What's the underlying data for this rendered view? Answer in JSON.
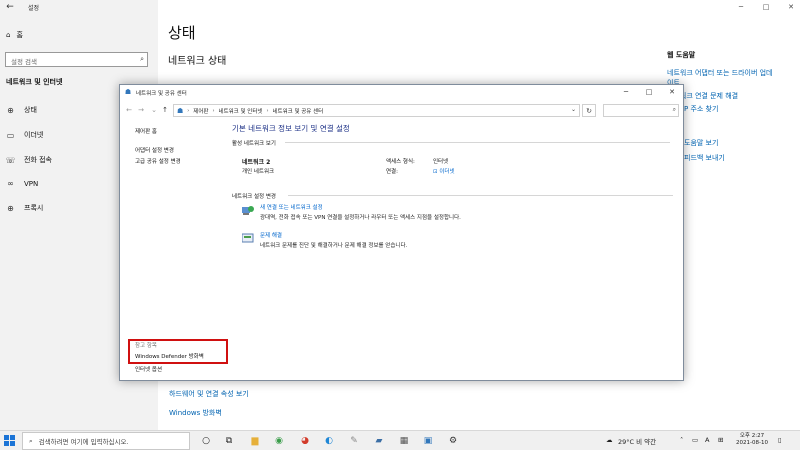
{
  "settings": {
    "window_title": "설정",
    "home": "홈",
    "search_placeholder": "설정 검색",
    "section_title": "네트워크 및 인터넷",
    "nav": [
      {
        "label": "상태",
        "icon": "home-network-icon"
      },
      {
        "label": "이더넷",
        "icon": "ethernet-icon"
      },
      {
        "label": "전화 접속",
        "icon": "dialup-icon"
      },
      {
        "label": "VPN",
        "icon": "vpn-icon"
      },
      {
        "label": "프록시",
        "icon": "globe-icon"
      }
    ],
    "page_title": "상태",
    "subtitle": "네트워크 상태",
    "help_title": "웹 도움말",
    "help_links": [
      "네트워크 어댑터 또는 드라이버 업데",
      "이트",
      "네트워크 연결 문제 해결",
      "P 주소 찾기"
    ],
    "help_links2": [
      "도움말 보기",
      "피드백 보내기"
    ],
    "bottom_links": [
      "하드웨어 및 연결 속성 보기",
      "Windows 방화벽"
    ]
  },
  "nsc": {
    "title": "네트워크 및 공유 센터",
    "breadcrumb": [
      "제어판",
      "네트워크 및 인터넷",
      "네트워크 및 공유 센터"
    ],
    "sidebar": [
      "제어판 홈",
      "어댑터 설정 변경",
      "고급 공유 설정 변경"
    ],
    "main_title": "기본 네트워크 정보 보기 및 연결 설정",
    "active_label": "활성 네트워크 보기",
    "network_name": "네트워크 2",
    "network_type": "개인 네트워크",
    "access_type_key": "액세스 형식:",
    "access_type_val": "인터넷",
    "connection_key": "연결:",
    "connection_val": "이더넷",
    "change_label": "네트워크 설정 변경",
    "task1_link": "새 연결 또는 네트워크 설정",
    "task1_desc": "광대역, 전화 접속 또는 VPN 연결을 설정하거나 라우터 또는 액세스 지점을 설정합니다.",
    "task2_link": "문제 해결",
    "task2_desc": "네트워크 문제를 진단 및 해결하거나 문제 해결 정보를 얻습니다.",
    "see_also": "참고 항목",
    "defender": "Windows Defender 방화벽",
    "internet_options": "인터넷 옵션"
  },
  "taskbar": {
    "search_placeholder": "검색하려면 여기에 입력하십시오.",
    "weather": "29°C 비 약간",
    "ime": "A",
    "clock_time": "오후 2:27",
    "clock_date": "2021-08-10"
  },
  "colors": {
    "accent": "#0063b1",
    "highlight": "#d01010",
    "link": "#0066cc"
  }
}
